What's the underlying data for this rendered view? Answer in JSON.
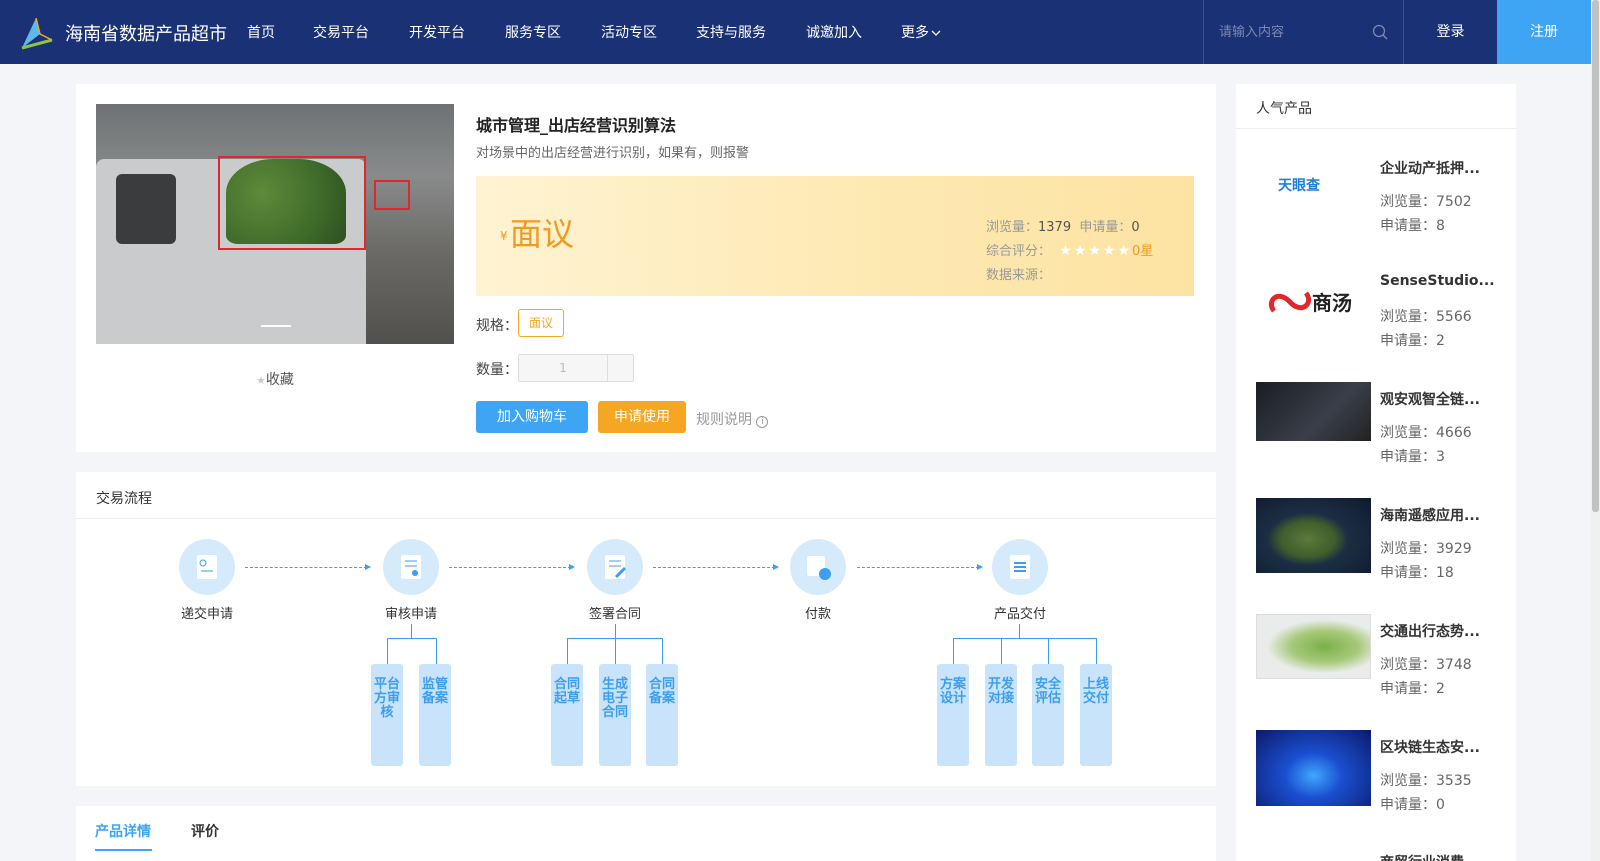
{
  "header": {
    "brand": "海南省数据产品超市",
    "nav": [
      "首页",
      "交易平台",
      "开发平台",
      "服务专区",
      "活动专区",
      "支持与服务",
      "诚邀加入",
      "更多"
    ],
    "search_placeholder": "请输入内容",
    "login": "登录",
    "register": "注册"
  },
  "product": {
    "title": "城市管理_出店经营识别算法",
    "desc": "对场景中的出店经营进行识别，如果有，则报警",
    "yen": "¥",
    "price": "面议",
    "views_label": "浏览量：",
    "views": "1379",
    "apply_label": "申请量：",
    "apply": "0",
    "rating_label": "综合评分：",
    "rating": "0星",
    "rating_value": 0,
    "source_label": "数据来源：",
    "spec_label": "规格：",
    "spec_value": "面议",
    "qty_label": "数量：",
    "qty_value": "1",
    "favorite": "收藏",
    "add_cart": "加入购物车",
    "apply_use": "申请使用",
    "rules": "规则说明"
  },
  "flow": {
    "title": "交易流程",
    "steps": [
      "递交申请",
      "审核申请",
      "签署合同",
      "付款",
      "产品交付"
    ],
    "sub1": [
      "平台方审核",
      "监管备案"
    ],
    "sub2": [
      "合同起草",
      "生成电子合同",
      "合同备案"
    ],
    "sub3": [
      "方案设计",
      "开发对接",
      "安全评估",
      "上线交付"
    ]
  },
  "tabs": [
    "产品详情",
    "评价"
  ],
  "sidebar": {
    "title": "人气产品",
    "items": [
      {
        "name": "企业动产抵押...",
        "views": "浏览量：7502",
        "apply": "申请量：8",
        "logo": "天眼查"
      },
      {
        "name": "SenseStudio...",
        "views": "浏览量：5566",
        "apply": "申请量：2",
        "logo": "商汤"
      },
      {
        "name": "观安观智全链...",
        "views": "浏览量：4666",
        "apply": "申请量：3"
      },
      {
        "name": "海南遥感应用...",
        "views": "浏览量：3929",
        "apply": "申请量：18"
      },
      {
        "name": "交通出行态势...",
        "views": "浏览量：3748",
        "apply": "申请量：2"
      },
      {
        "name": "区块链生态安...",
        "views": "浏览量：3535",
        "apply": "申请量：0"
      },
      {
        "name": "商贸行业消费..."
      }
    ]
  },
  "colors": {
    "header": "#1a3175",
    "accent": "#3ea5f5",
    "orange": "#f5a623"
  }
}
